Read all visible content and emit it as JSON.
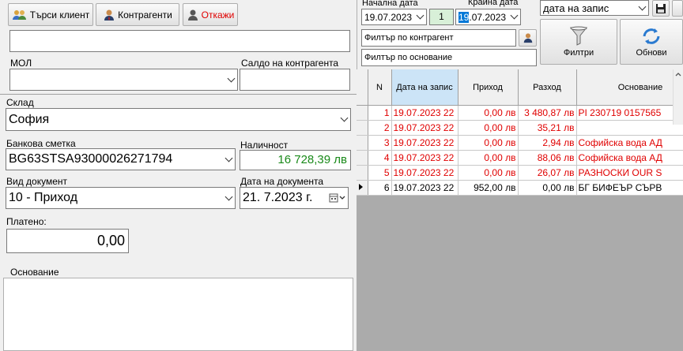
{
  "toolbar": {
    "search_client": "Търси клиент",
    "counterparties": "Контрагенти",
    "cancel": "Откажи"
  },
  "form": {
    "mol_label": "МОЛ",
    "balance_label": "Салдо на контрагента",
    "warehouse_label": "Склад",
    "warehouse_value": "София",
    "bank_account_label": "Банкова сметка",
    "bank_account_value": "BG63STSA93000026271794",
    "availability_label": "Наличност",
    "availability_value": "16 728,39 лв",
    "doc_type_label": "Вид документ",
    "doc_type_value": "10 - Приход",
    "doc_date_label": "Дата на документа",
    "doc_date_value": "21.  7.2023 г.",
    "paid_label": "Платено:",
    "paid_value": "0,00",
    "reason_label": "Основание"
  },
  "filters": {
    "start_date_label": "Начална дата",
    "start_date_value": "19.07.2023",
    "days_value": "1",
    "end_date_label": "Крайна дата",
    "end_date_value": "19.07.2023",
    "end_date_highlight": "19",
    "end_date_rest": ".07.2023",
    "sort_value": "дата на запис",
    "counterparty_filter": "Филтър по контрагент",
    "reason_filter": "Филтър по основание",
    "filter_button": "Филтри",
    "refresh_button": "Обнови"
  },
  "grid": {
    "columns": [
      "N",
      "Дата на запис",
      "Приход",
      "Разход",
      "Основание"
    ],
    "rows": [
      {
        "n": "1",
        "date": "19.07.2023 22",
        "income": "0,00 лв",
        "expense": "3 480,87 лв",
        "reason": "PI 230719 0157565",
        "color": "red"
      },
      {
        "n": "2",
        "date": "19.07.2023 22",
        "income": "0,00 лв",
        "expense": "35,21 лв",
        "reason": "",
        "color": "red"
      },
      {
        "n": "3",
        "date": "19.07.2023 22",
        "income": "0,00 лв",
        "expense": "2,94 лв",
        "reason": "Софийска вода АД",
        "color": "red"
      },
      {
        "n": "4",
        "date": "19.07.2023 22",
        "income": "0,00 лв",
        "expense": "88,06 лв",
        "reason": "Софийска вода АД",
        "color": "red"
      },
      {
        "n": "5",
        "date": "19.07.2023 22",
        "income": "0,00 лв",
        "expense": "26,07 лв",
        "reason": "РАЗНОСКИ OUR S",
        "color": "red"
      },
      {
        "n": "6",
        "date": "19.07.2023 22",
        "income": "952,00 лв",
        "expense": "0,00 лв",
        "reason": "БГ БИФЕЪР СЪРВ",
        "color": "black"
      }
    ]
  },
  "colors": {
    "income_red": "#e00000",
    "availability_green": "#1a8a1a",
    "selected_header": "#cce4f7",
    "day_box": "#d8f0d8"
  }
}
